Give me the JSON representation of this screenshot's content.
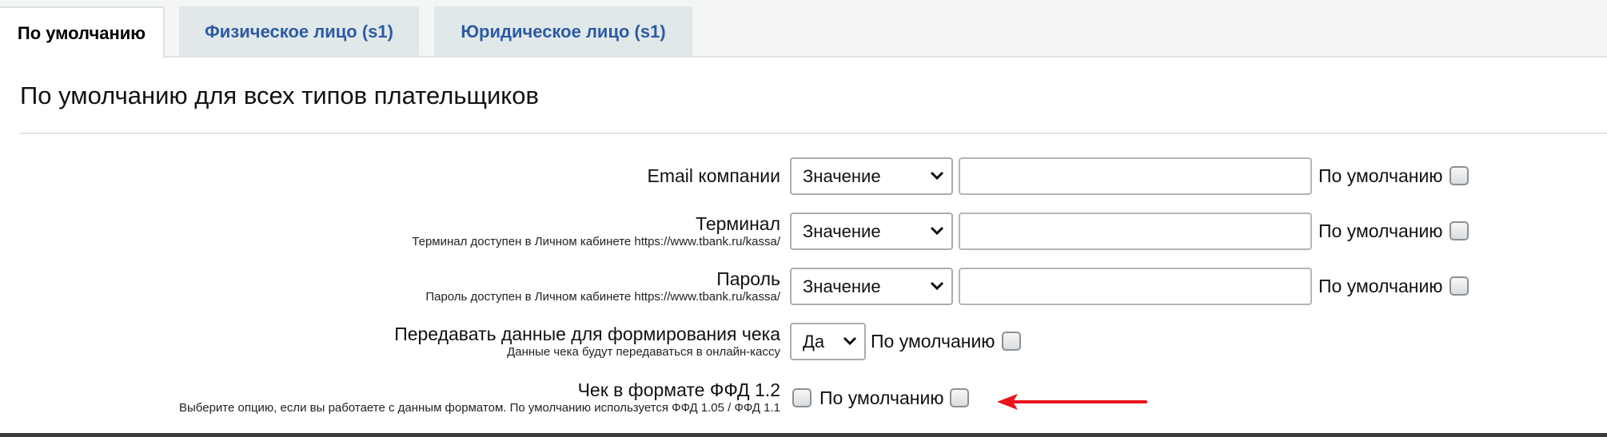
{
  "tabs": [
    {
      "label": "По умолчанию",
      "active": true
    },
    {
      "label": "Физическое лицо (s1)",
      "active": false
    },
    {
      "label": "Юридическое лицо (s1)",
      "active": false
    }
  ],
  "section": {
    "title": "По умолчанию для всех типов плательщиков"
  },
  "rows": [
    {
      "label": "Email компании",
      "hint": "",
      "select_value": "Значение",
      "input_value": "",
      "default_label": "По умолчанию"
    },
    {
      "label": "Терминал",
      "hint": "Терминал доступен в Личном кабинете https://www.tbank.ru/kassa/",
      "select_value": "Значение",
      "input_value": "",
      "default_label": "По умолчанию"
    },
    {
      "label": "Пароль",
      "hint": "Пароль доступен в Личном кабинете https://www.tbank.ru/kassa/",
      "select_value": "Значение",
      "input_value": "",
      "default_label": "По умолчанию"
    },
    {
      "label": "Передавать данные для формирования чека",
      "hint": "Данные чека будут передаваться в онлайн-кассу",
      "select_value": "Да",
      "default_label": "По умолчанию"
    },
    {
      "label": "Чек в формате ФФД 1.2",
      "hint": "Выберите опцию, если вы работаете с данным форматом. По умолчанию используется ФФД 1.05 / ФФД 1.1",
      "checked": false,
      "default_label": "По умолчанию"
    }
  ],
  "colors": {
    "tab_link": "#2d5ba3",
    "arrow": "#e8141c"
  },
  "icons": {
    "select_chevron": "chevron-down-icon",
    "annotation": "red-arrow-icon"
  }
}
